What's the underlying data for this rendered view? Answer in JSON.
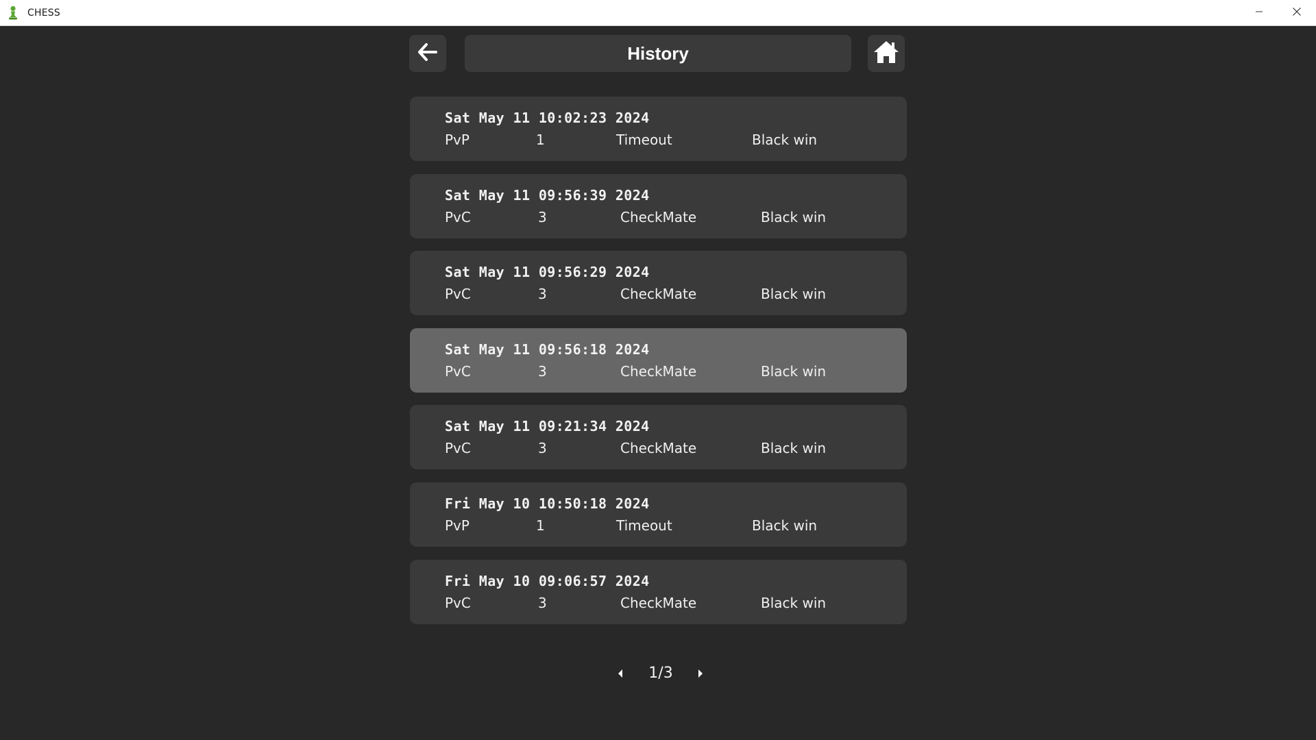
{
  "window": {
    "title": "CHESS",
    "app_icon": "chess-pawn-icon",
    "controls": [
      "minimize-icon",
      "close-icon"
    ]
  },
  "header": {
    "title": "History",
    "back_icon": "arrow-left-icon",
    "home_icon": "home-icon"
  },
  "history": [
    {
      "date": "Sat May 11 10:02:23 2024",
      "mode": "PvP",
      "level": "1",
      "reason": "Timeout",
      "result": "Black win",
      "selected": false
    },
    {
      "date": "Sat May 11 09:56:39 2024",
      "mode": "PvC",
      "level": "3",
      "reason": "CheckMate",
      "result": "Black win",
      "selected": false
    },
    {
      "date": "Sat May 11 09:56:29 2024",
      "mode": "PvC",
      "level": "3",
      "reason": "CheckMate",
      "result": "Black win",
      "selected": false
    },
    {
      "date": "Sat May 11 09:56:18 2024",
      "mode": "PvC",
      "level": "3",
      "reason": "CheckMate",
      "result": "Black win",
      "selected": true
    },
    {
      "date": "Sat May 11 09:21:34 2024",
      "mode": "PvC",
      "level": "3",
      "reason": "CheckMate",
      "result": "Black win",
      "selected": false
    },
    {
      "date": "Fri May 10 10:50:18 2024",
      "mode": "PvP",
      "level": "1",
      "reason": "Timeout",
      "result": "Black win",
      "selected": false
    },
    {
      "date": "Fri May 10 09:06:57 2024",
      "mode": "PvC",
      "level": "3",
      "reason": "CheckMate",
      "result": "Black win",
      "selected": false
    }
  ],
  "pagination": {
    "label": "1/3",
    "prev_icon": "caret-left-icon",
    "next_icon": "caret-right-icon"
  },
  "colors": {
    "background": "#282828",
    "card": "#3a3a3a",
    "card_selected": "#676767",
    "text": "#f2f2f2",
    "app_icon": "#5aa832"
  }
}
